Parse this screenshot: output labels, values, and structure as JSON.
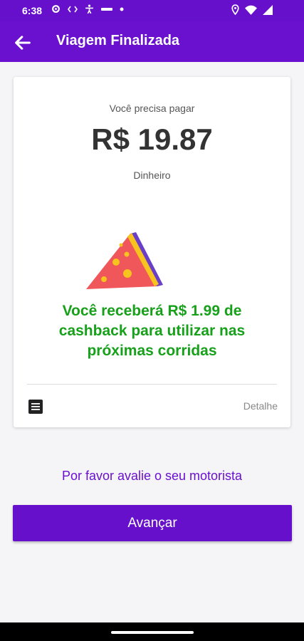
{
  "status_bar": {
    "time": "6:38"
  },
  "app_bar": {
    "title": "Viagem Finalizada",
    "back_icon": "arrow-left-icon"
  },
  "payment": {
    "label": "Você precisa pagar",
    "amount": "R$ 19.87",
    "method": "Dinheiro"
  },
  "promo": {
    "image": "pizza-slice-illustration",
    "text": "Você receberá R$ 1.99 de cashback para utilizar nas próximas corridas"
  },
  "footer_row": {
    "icon": "receipt-icon",
    "detail_label": "Detalhe"
  },
  "rate_driver": "Por favor avalie o seu motorista",
  "next_button": "Avançar",
  "colors": {
    "primary": "#6a10cf",
    "cashback_green": "#17a01a"
  }
}
